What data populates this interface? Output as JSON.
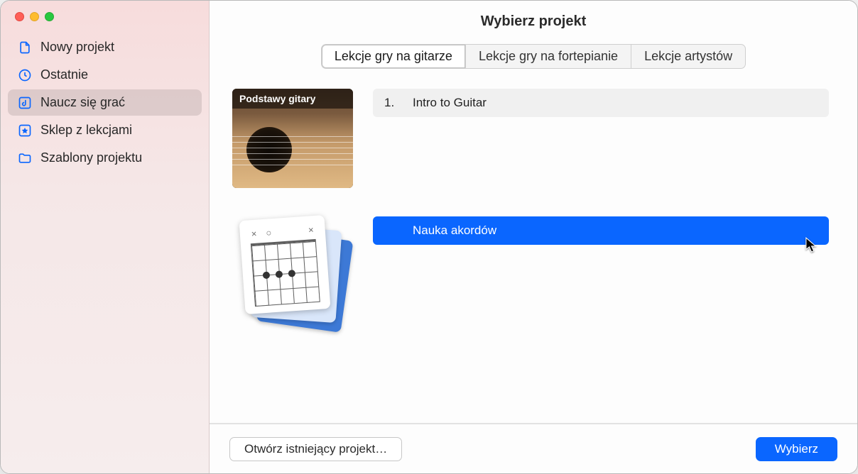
{
  "window": {
    "title": "Wybierz projekt"
  },
  "sidebar": {
    "items": [
      {
        "label": "Nowy projekt",
        "icon": "file-icon",
        "selected": false
      },
      {
        "label": "Ostatnie",
        "icon": "clock-icon",
        "selected": false
      },
      {
        "label": "Naucz się grać",
        "icon": "note-box-icon",
        "selected": true
      },
      {
        "label": "Sklep z lekcjami",
        "icon": "star-box-icon",
        "selected": false
      },
      {
        "label": "Szablony projektu",
        "icon": "folder-icon",
        "selected": false
      }
    ]
  },
  "tabs": [
    {
      "label": "Lekcje gry na gitarze",
      "active": true
    },
    {
      "label": "Lekcje gry na fortepianie",
      "active": false
    },
    {
      "label": "Lekcje artystów",
      "active": false
    }
  ],
  "sections": [
    {
      "thumb_label": "Podstawy gitary",
      "thumb_kind": "guitar",
      "rows": [
        {
          "num": "1.",
          "title": "Intro to Guitar",
          "selected": false
        }
      ]
    },
    {
      "thumb_label": "",
      "thumb_kind": "chord",
      "rows": [
        {
          "num": "",
          "title": "Nauka akordów",
          "selected": true
        }
      ]
    }
  ],
  "footer": {
    "open_existing": "Otwórz istniejący projekt…",
    "choose": "Wybierz"
  }
}
